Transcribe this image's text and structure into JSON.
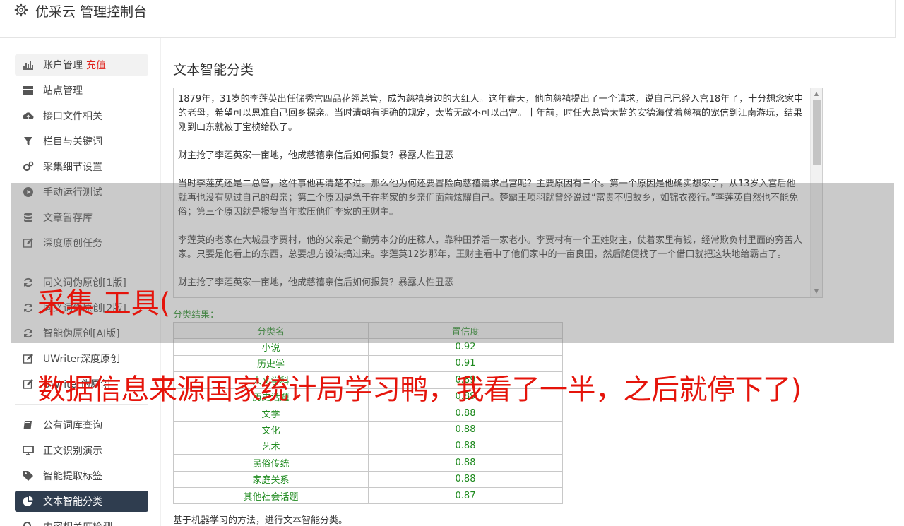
{
  "app": {
    "title": "优采云 管理控制台",
    "icon": "gear-icon"
  },
  "sidebar": {
    "items": [
      {
        "label": "账户管理",
        "badge": "充值",
        "icon": "bar-chart-icon"
      },
      {
        "label": "站点管理",
        "icon": "server-icon"
      },
      {
        "label": "接口文件相关",
        "icon": "cloud-upload-icon"
      },
      {
        "label": "栏目与关键词",
        "icon": "filter-icon"
      },
      {
        "label": "采集细节设置",
        "icon": "gears-icon"
      },
      {
        "label": "手动运行测试",
        "icon": "play-circle-icon"
      },
      {
        "label": "文章暂存库",
        "icon": "database-icon"
      },
      {
        "label": "深度原创任务",
        "icon": "edit-icon"
      },
      {
        "label": "同义词伪原创[1版]",
        "icon": "refresh-icon"
      },
      {
        "label": "同义词伪原创[2版]",
        "icon": "refresh-icon"
      },
      {
        "label": "智能伪原创[AI版]",
        "icon": "refresh-icon"
      },
      {
        "label": "UWriter深度原创",
        "icon": "edit-icon"
      },
      {
        "label": "UWriter伪原创",
        "icon": "edit-icon"
      },
      {
        "label": "公有词库查询",
        "icon": "book-icon"
      },
      {
        "label": "正文识别演示",
        "icon": "monitor-icon"
      },
      {
        "label": "智能提取标签",
        "icon": "tag-icon"
      },
      {
        "label": "文本智能分类",
        "icon": "pie-chart-icon"
      },
      {
        "label": "内容相关度检测",
        "icon": "search-icon"
      }
    ]
  },
  "main": {
    "heading": "文本智能分类",
    "textarea_paragraphs": [
      "1879年，31岁的李莲英出任储秀宫四品花翎总管，成为慈禧身边的大红人。这年春天，他向慈禧提出了一个请求，说自己已经入宫18年了，十分想念家中的老母，希望可以恩准自己回乡探亲。当时清朝有明确的规定，太监无故不可以出宫。十年前，时任大总管太监的安德海仗着慈禧的宠信到江南游玩，结果刚到山东就被丁宝桢给砍了。",
      "财主抢了李莲英家一亩地，他成慈禧亲信后如何报复？暴露人性丑恶",
      "当时李莲英还是二总管，这件事他再清楚不过。那么他为何还要冒险向慈禧请求出宫呢？主要原因有三个。第一个原因是他确实想家了，从13岁入宫后他就再也没有见过自己的母亲；第二个原因是急于在老家的乡亲们面前炫耀自己。楚霸王项羽就曾经说过“富贵不归故乡，如锦衣夜行。”李莲英自然也不能免俗；第三个原因就是报复当年欺压他们李家的王财主。",
      "李莲英的老家在大城县李贾村，他的父亲是个勤劳本分的庄稼人，靠种田养活一家老小。李贾村有一个王姓财主，仗着家里有钱，经常欺负村里面的穷苦人家。只要是他看上的东西，总要想方设法搞过来。李莲英12岁那年，王财主看中了他们家中的一亩良田，然后随便找了一个借口就把这块地给霸占了。",
      "财主抢了李莲英家一亩地，他成慈禧亲信后如何报复？暴露人性丑恶"
    ],
    "result_label": "分类结果：",
    "table": {
      "headers": [
        "分类名",
        "置信度"
      ],
      "rows": [
        [
          "小说",
          "0.92"
        ],
        [
          "历史学",
          "0.91"
        ],
        [
          "人文学科",
          "0.89"
        ],
        [
          "历史话题",
          "0.89"
        ],
        [
          "文学",
          "0.88"
        ],
        [
          "文化",
          "0.88"
        ],
        [
          "艺术",
          "0.88"
        ],
        [
          "民俗传统",
          "0.88"
        ],
        [
          "家庭关系",
          "0.88"
        ],
        [
          "其他社会话题",
          "0.87"
        ]
      ]
    },
    "footnote": "基于机器学习的方法，进行文本智能分类。"
  },
  "overlay": {
    "line1": "采集 工具(",
    "line2": "数据信息来源国家统计局学习鸭，我看了一半，之后就停下了)"
  },
  "colors": {
    "accent_red": "#e5140b",
    "active_nav": "#2f3d4f",
    "result_green": "#1f8a1f"
  }
}
